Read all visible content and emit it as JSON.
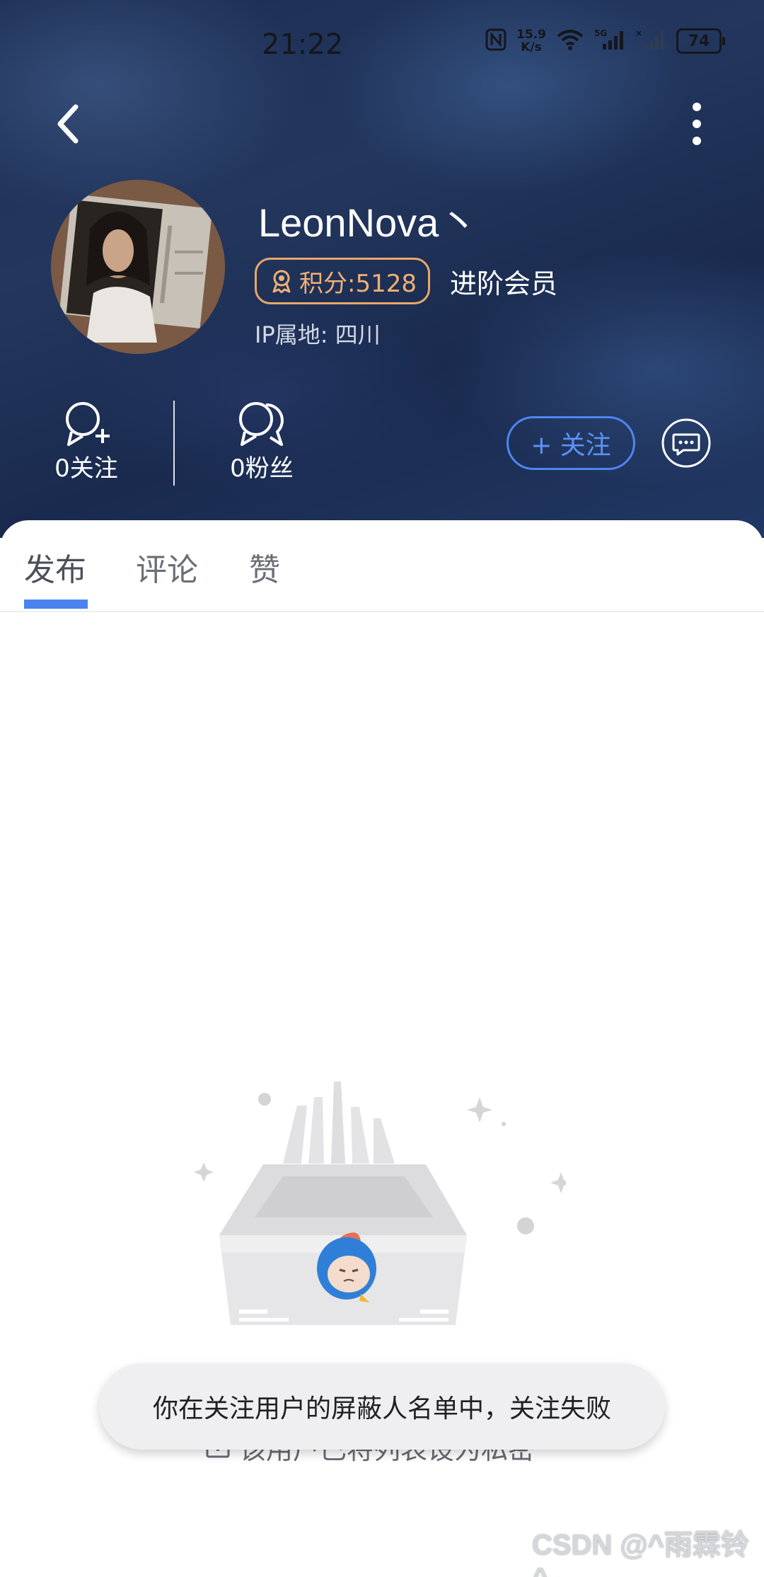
{
  "status_bar": {
    "time": "21:22",
    "net_speed_value": "15.9",
    "net_speed_unit": "K/s",
    "battery": "74",
    "icons": [
      "nfc-icon",
      "wifi-icon",
      "signal-5g-icon",
      "signal-icon",
      "battery-icon"
    ]
  },
  "header": {
    "back_icon": "chevron-left-icon",
    "more_icon": "more-vertical-icon"
  },
  "profile": {
    "username": "LeonNova丶",
    "points_label": "积分:5128",
    "member_label": "进阶会员",
    "ip_location": "IP属地: 四川",
    "following_label": "0关注",
    "fans_label": "0粉丝",
    "follow_button_label": "+ 关注",
    "message_icon": "chat-bubble-icon"
  },
  "tabs": [
    {
      "label": "发布",
      "active": true
    },
    {
      "label": "评论",
      "active": false
    },
    {
      "label": "赞",
      "active": false
    }
  ],
  "empty_state": {
    "text": "该用户已将列表设为私密"
  },
  "toast": {
    "text": "你在关注用户的屏蔽人名单中，关注失败"
  },
  "watermark": {
    "text": "CSDN @^雨霖铃^"
  },
  "colors": {
    "accent": "#4a83f0",
    "badge": "#e8a868",
    "header_bg": "#1f3158"
  }
}
